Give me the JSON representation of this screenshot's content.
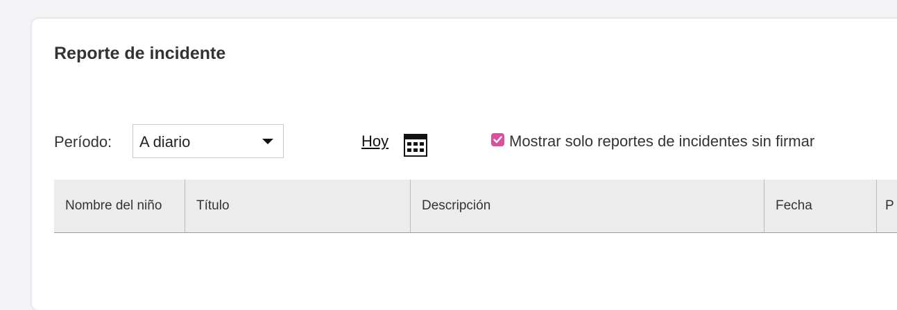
{
  "page": {
    "title": "Reporte de incidente"
  },
  "filters": {
    "period_label": "Período:",
    "period_value": "A diario",
    "today_link": "Hoy",
    "calendar_icon": "calendar-icon",
    "unsigned_only_checked": true,
    "unsigned_only_label": "Mostrar solo reportes de incidentes sin firmar"
  },
  "table": {
    "columns": [
      "Nombre del niño",
      "Título",
      "Descripción",
      "Fecha",
      "P"
    ],
    "rows": []
  },
  "colors": {
    "accent": "#d9519a",
    "header_bg": "#ececec",
    "text": "#333333"
  }
}
